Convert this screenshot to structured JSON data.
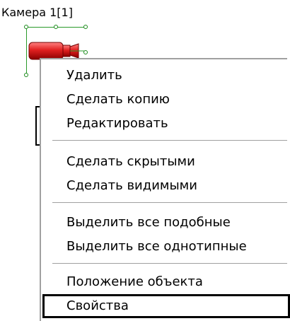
{
  "camera_object": {
    "label": "Камера 1[1]",
    "icon": "camera-icon",
    "icon_color": "#d42020",
    "selection_color": "#2a9a2a"
  },
  "context_menu": {
    "groups": [
      {
        "items": [
          {
            "label": "Удалить"
          },
          {
            "label": "Сделать копию"
          },
          {
            "label": "Редактировать"
          }
        ]
      },
      {
        "items": [
          {
            "label": "Сделать скрытыми"
          },
          {
            "label": "Сделать видимыми"
          }
        ]
      },
      {
        "items": [
          {
            "label": "Выделить все подобные"
          },
          {
            "label": "Выделить все однотипные"
          }
        ]
      },
      {
        "items": [
          {
            "label": "Положение объекта"
          },
          {
            "label": "Свойства",
            "highlighted": true
          }
        ]
      }
    ]
  }
}
